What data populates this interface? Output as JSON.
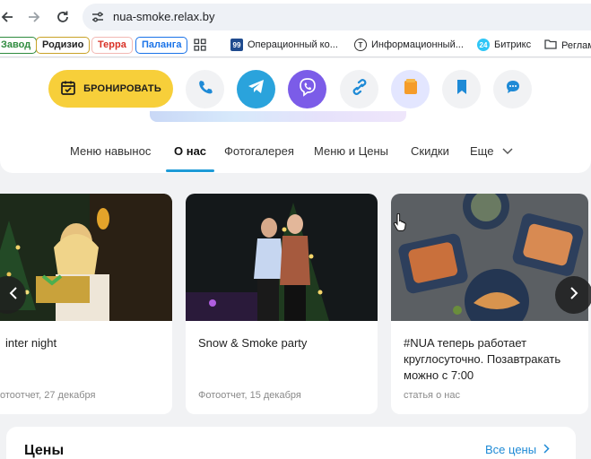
{
  "browser": {
    "url": "nua-smoke.relax.by",
    "bookmarks_colored": [
      {
        "label": "Завод",
        "color": "#2e8b3e"
      },
      {
        "label": "Родизио",
        "color": "#c9a227"
      },
      {
        "label": "Терра",
        "color": "#d93025"
      },
      {
        "label": "Паланга",
        "color": "#1a73e8"
      }
    ],
    "bookmarks": [
      {
        "label": "Операционный ко...",
        "icon": "nines-icon"
      },
      {
        "label": "Информационный...",
        "icon": "t-circle-icon"
      },
      {
        "label": "Битрикс",
        "icon": "bitrix-icon"
      },
      {
        "label": "Реглам",
        "icon": "folder-icon"
      }
    ]
  },
  "actions": {
    "book_label": "БРОНИРОВАТЬ",
    "icons": [
      "phone-icon",
      "telegram-icon",
      "viber-icon",
      "link-icon",
      "card-icon",
      "bookmark-icon",
      "chat-icon"
    ]
  },
  "tabs": [
    {
      "label": "Меню навынос"
    },
    {
      "label": "О нас"
    },
    {
      "label": "Фотогалерея"
    },
    {
      "label": "Меню и Цены"
    },
    {
      "label": "Скидки"
    },
    {
      "label": "Еще"
    }
  ],
  "cards": [
    {
      "title": "inter night",
      "meta": "отоотчет, 27 декабря"
    },
    {
      "title": "Snow & Smoke party",
      "meta": "Фотоотчет, 15 декабря"
    },
    {
      "title": "#NUA теперь работает круглосуточно. Позавтракать можно с 7:00",
      "meta": "статья о нас"
    }
  ],
  "prices": {
    "heading": "Цены",
    "all_link": "Все цены"
  },
  "colors": {
    "accent_yellow": "#f7cf3a",
    "telegram": "#2aa3dc",
    "viber": "#7b5ce8",
    "tab_active": "#1e9bd7",
    "link": "#1e8ad6"
  }
}
